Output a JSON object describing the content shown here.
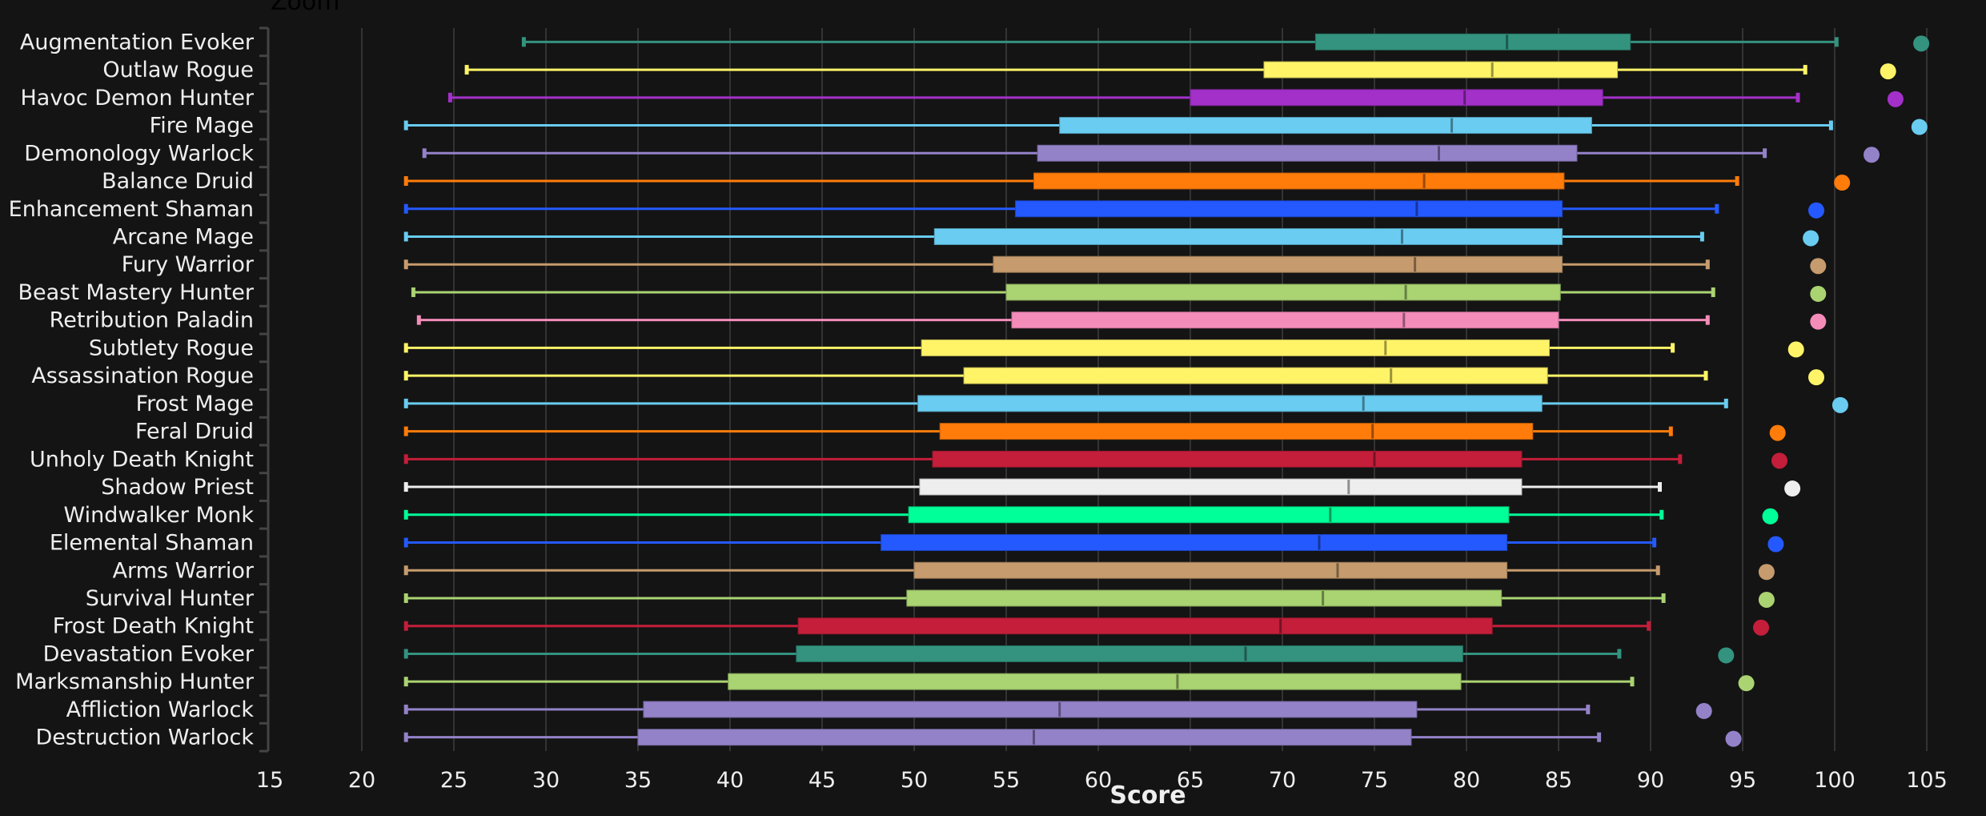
{
  "zoom_label": "Zoom",
  "chart_data": {
    "type": "boxplot",
    "title": "",
    "xlabel": "Score",
    "ylabel": "",
    "xlim": [
      15,
      105
    ],
    "xticks": [
      15,
      20,
      25,
      30,
      35,
      40,
      45,
      50,
      55,
      60,
      65,
      70,
      75,
      80,
      85,
      90,
      95,
      100,
      105
    ],
    "grid": true,
    "series": [
      {
        "name": "Augmentation Evoker",
        "color": "#33937F",
        "min": 28.8,
        "q1": 71.8,
        "median": 82.2,
        "q3": 88.9,
        "max": 100.1,
        "outlier": 104.7
      },
      {
        "name": "Outlaw Rogue",
        "color": "#FFF468",
        "min": 25.7,
        "q1": 69.0,
        "median": 81.4,
        "q3": 88.2,
        "max": 98.4,
        "outlier": 102.9
      },
      {
        "name": "Havoc Demon Hunter",
        "color": "#A330C9",
        "min": 24.8,
        "q1": 65.0,
        "median": 79.9,
        "q3": 87.4,
        "max": 98.0,
        "outlier": 103.3
      },
      {
        "name": "Fire Mage",
        "color": "#69CCF0",
        "min": 22.4,
        "q1": 57.9,
        "median": 79.2,
        "q3": 86.8,
        "max": 99.8,
        "outlier": 104.6
      },
      {
        "name": "Demonology Warlock",
        "color": "#9482C9",
        "min": 23.4,
        "q1": 56.7,
        "median": 78.5,
        "q3": 86.0,
        "max": 96.2,
        "outlier": 102.0
      },
      {
        "name": "Balance Druid",
        "color": "#FF7C0A",
        "min": 22.4,
        "q1": 56.5,
        "median": 77.7,
        "q3": 85.3,
        "max": 94.7,
        "outlier": 100.4
      },
      {
        "name": "Enhancement Shaman",
        "color": "#2459FF",
        "min": 22.4,
        "q1": 55.5,
        "median": 77.3,
        "q3": 85.2,
        "max": 93.6,
        "outlier": 99.0
      },
      {
        "name": "Arcane Mage",
        "color": "#69CCF0",
        "min": 22.4,
        "q1": 51.1,
        "median": 76.5,
        "q3": 85.2,
        "max": 92.8,
        "outlier": 98.7
      },
      {
        "name": "Fury Warrior",
        "color": "#C69B6D",
        "min": 22.4,
        "q1": 54.3,
        "median": 77.2,
        "q3": 85.2,
        "max": 93.1,
        "outlier": 99.1
      },
      {
        "name": "Beast Mastery Hunter",
        "color": "#AAD372",
        "min": 22.8,
        "q1": 55.0,
        "median": 76.7,
        "q3": 85.1,
        "max": 93.4,
        "outlier": 99.1
      },
      {
        "name": "Retribution Paladin",
        "color": "#F48CBA",
        "min": 23.1,
        "q1": 55.3,
        "median": 76.6,
        "q3": 85.0,
        "max": 93.1,
        "outlier": 99.1
      },
      {
        "name": "Subtlety Rogue",
        "color": "#FFF468",
        "min": 22.4,
        "q1": 50.4,
        "median": 75.6,
        "q3": 84.5,
        "max": 91.2,
        "outlier": 97.9
      },
      {
        "name": "Assassination Rogue",
        "color": "#FFF468",
        "min": 22.4,
        "q1": 52.7,
        "median": 75.9,
        "q3": 84.4,
        "max": 93.0,
        "outlier": 99.0
      },
      {
        "name": "Frost Mage",
        "color": "#69CCF0",
        "min": 22.4,
        "q1": 50.2,
        "median": 74.4,
        "q3": 84.1,
        "max": 94.1,
        "outlier": 100.3
      },
      {
        "name": "Feral Druid",
        "color": "#FF7C0A",
        "min": 22.4,
        "q1": 51.4,
        "median": 74.9,
        "q3": 83.6,
        "max": 91.1,
        "outlier": 96.9
      },
      {
        "name": "Unholy Death Knight",
        "color": "#C41E3A",
        "min": 22.4,
        "q1": 51.0,
        "median": 75.0,
        "q3": 83.0,
        "max": 91.6,
        "outlier": 97.0
      },
      {
        "name": "Shadow Priest",
        "color": "#EEEEEE",
        "min": 22.4,
        "q1": 50.3,
        "median": 73.6,
        "q3": 83.0,
        "max": 90.5,
        "outlier": 97.7
      },
      {
        "name": "Windwalker Monk",
        "color": "#00FF98",
        "min": 22.4,
        "q1": 49.7,
        "median": 72.6,
        "q3": 82.3,
        "max": 90.6,
        "outlier": 96.5
      },
      {
        "name": "Elemental Shaman",
        "color": "#2459FF",
        "min": 22.4,
        "q1": 48.2,
        "median": 72.0,
        "q3": 82.2,
        "max": 90.2,
        "outlier": 96.8
      },
      {
        "name": "Arms Warrior",
        "color": "#C69B6D",
        "min": 22.4,
        "q1": 50.0,
        "median": 73.0,
        "q3": 82.2,
        "max": 90.4,
        "outlier": 96.3
      },
      {
        "name": "Survival Hunter",
        "color": "#AAD372",
        "min": 22.4,
        "q1": 49.6,
        "median": 72.2,
        "q3": 81.9,
        "max": 90.7,
        "outlier": 96.3
      },
      {
        "name": "Frost Death Knight",
        "color": "#C41E3A",
        "min": 22.4,
        "q1": 43.7,
        "median": 69.9,
        "q3": 81.4,
        "max": 89.9,
        "outlier": 96.0
      },
      {
        "name": "Devastation Evoker",
        "color": "#33937F",
        "min": 22.4,
        "q1": 43.6,
        "median": 68.0,
        "q3": 79.8,
        "max": 88.3,
        "outlier": 94.1
      },
      {
        "name": "Marksmanship Hunter",
        "color": "#AAD372",
        "min": 22.4,
        "q1": 39.9,
        "median": 64.3,
        "q3": 79.7,
        "max": 89.0,
        "outlier": 95.2
      },
      {
        "name": "Affliction Warlock",
        "color": "#9482C9",
        "min": 22.4,
        "q1": 35.3,
        "median": 57.9,
        "q3": 77.3,
        "max": 86.6,
        "outlier": 92.9
      },
      {
        "name": "Destruction Warlock",
        "color": "#9482C9",
        "min": 22.4,
        "q1": 35.0,
        "median": 56.5,
        "q3": 77.0,
        "max": 87.2,
        "outlier": 94.5
      }
    ]
  }
}
